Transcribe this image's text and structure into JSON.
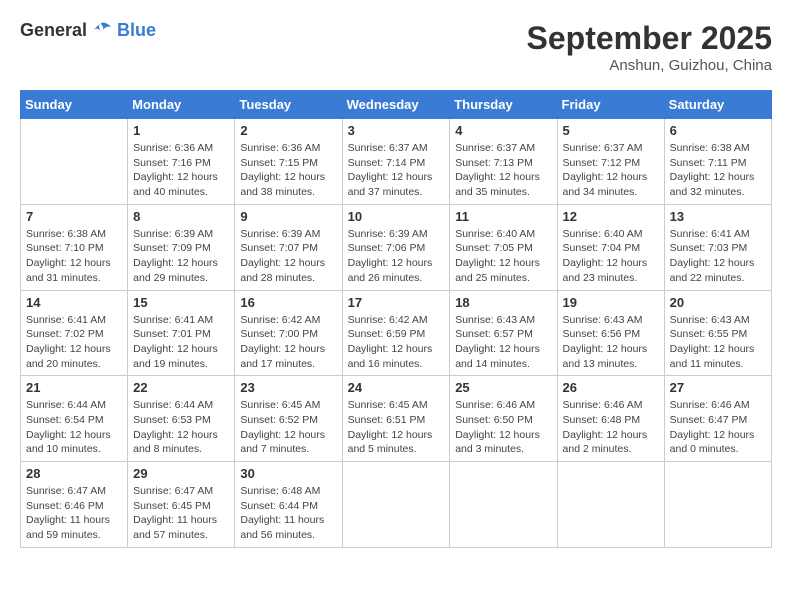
{
  "header": {
    "logo": {
      "general": "General",
      "blue": "Blue"
    },
    "month": "September 2025",
    "location": "Anshun, Guizhou, China"
  },
  "weekdays": [
    "Sunday",
    "Monday",
    "Tuesday",
    "Wednesday",
    "Thursday",
    "Friday",
    "Saturday"
  ],
  "weeks": [
    [
      {
        "day": "",
        "info": ""
      },
      {
        "day": "1",
        "info": "Sunrise: 6:36 AM\nSunset: 7:16 PM\nDaylight: 12 hours\nand 40 minutes."
      },
      {
        "day": "2",
        "info": "Sunrise: 6:36 AM\nSunset: 7:15 PM\nDaylight: 12 hours\nand 38 minutes."
      },
      {
        "day": "3",
        "info": "Sunrise: 6:37 AM\nSunset: 7:14 PM\nDaylight: 12 hours\nand 37 minutes."
      },
      {
        "day": "4",
        "info": "Sunrise: 6:37 AM\nSunset: 7:13 PM\nDaylight: 12 hours\nand 35 minutes."
      },
      {
        "day": "5",
        "info": "Sunrise: 6:37 AM\nSunset: 7:12 PM\nDaylight: 12 hours\nand 34 minutes."
      },
      {
        "day": "6",
        "info": "Sunrise: 6:38 AM\nSunset: 7:11 PM\nDaylight: 12 hours\nand 32 minutes."
      }
    ],
    [
      {
        "day": "7",
        "info": "Sunrise: 6:38 AM\nSunset: 7:10 PM\nDaylight: 12 hours\nand 31 minutes."
      },
      {
        "day": "8",
        "info": "Sunrise: 6:39 AM\nSunset: 7:09 PM\nDaylight: 12 hours\nand 29 minutes."
      },
      {
        "day": "9",
        "info": "Sunrise: 6:39 AM\nSunset: 7:07 PM\nDaylight: 12 hours\nand 28 minutes."
      },
      {
        "day": "10",
        "info": "Sunrise: 6:39 AM\nSunset: 7:06 PM\nDaylight: 12 hours\nand 26 minutes."
      },
      {
        "day": "11",
        "info": "Sunrise: 6:40 AM\nSunset: 7:05 PM\nDaylight: 12 hours\nand 25 minutes."
      },
      {
        "day": "12",
        "info": "Sunrise: 6:40 AM\nSunset: 7:04 PM\nDaylight: 12 hours\nand 23 minutes."
      },
      {
        "day": "13",
        "info": "Sunrise: 6:41 AM\nSunset: 7:03 PM\nDaylight: 12 hours\nand 22 minutes."
      }
    ],
    [
      {
        "day": "14",
        "info": "Sunrise: 6:41 AM\nSunset: 7:02 PM\nDaylight: 12 hours\nand 20 minutes."
      },
      {
        "day": "15",
        "info": "Sunrise: 6:41 AM\nSunset: 7:01 PM\nDaylight: 12 hours\nand 19 minutes."
      },
      {
        "day": "16",
        "info": "Sunrise: 6:42 AM\nSunset: 7:00 PM\nDaylight: 12 hours\nand 17 minutes."
      },
      {
        "day": "17",
        "info": "Sunrise: 6:42 AM\nSunset: 6:59 PM\nDaylight: 12 hours\nand 16 minutes."
      },
      {
        "day": "18",
        "info": "Sunrise: 6:43 AM\nSunset: 6:57 PM\nDaylight: 12 hours\nand 14 minutes."
      },
      {
        "day": "19",
        "info": "Sunrise: 6:43 AM\nSunset: 6:56 PM\nDaylight: 12 hours\nand 13 minutes."
      },
      {
        "day": "20",
        "info": "Sunrise: 6:43 AM\nSunset: 6:55 PM\nDaylight: 12 hours\nand 11 minutes."
      }
    ],
    [
      {
        "day": "21",
        "info": "Sunrise: 6:44 AM\nSunset: 6:54 PM\nDaylight: 12 hours\nand 10 minutes."
      },
      {
        "day": "22",
        "info": "Sunrise: 6:44 AM\nSunset: 6:53 PM\nDaylight: 12 hours\nand 8 minutes."
      },
      {
        "day": "23",
        "info": "Sunrise: 6:45 AM\nSunset: 6:52 PM\nDaylight: 12 hours\nand 7 minutes."
      },
      {
        "day": "24",
        "info": "Sunrise: 6:45 AM\nSunset: 6:51 PM\nDaylight: 12 hours\nand 5 minutes."
      },
      {
        "day": "25",
        "info": "Sunrise: 6:46 AM\nSunset: 6:50 PM\nDaylight: 12 hours\nand 3 minutes."
      },
      {
        "day": "26",
        "info": "Sunrise: 6:46 AM\nSunset: 6:48 PM\nDaylight: 12 hours\nand 2 minutes."
      },
      {
        "day": "27",
        "info": "Sunrise: 6:46 AM\nSunset: 6:47 PM\nDaylight: 12 hours\nand 0 minutes."
      }
    ],
    [
      {
        "day": "28",
        "info": "Sunrise: 6:47 AM\nSunset: 6:46 PM\nDaylight: 11 hours\nand 59 minutes."
      },
      {
        "day": "29",
        "info": "Sunrise: 6:47 AM\nSunset: 6:45 PM\nDaylight: 11 hours\nand 57 minutes."
      },
      {
        "day": "30",
        "info": "Sunrise: 6:48 AM\nSunset: 6:44 PM\nDaylight: 11 hours\nand 56 minutes."
      },
      {
        "day": "",
        "info": ""
      },
      {
        "day": "",
        "info": ""
      },
      {
        "day": "",
        "info": ""
      },
      {
        "day": "",
        "info": ""
      }
    ]
  ]
}
